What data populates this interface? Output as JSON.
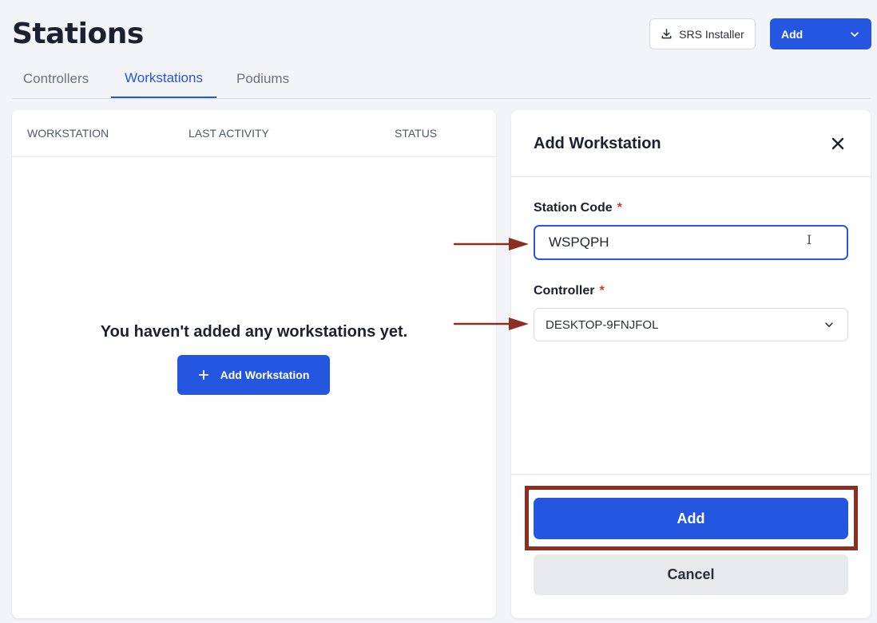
{
  "header": {
    "title": "Stations",
    "srs_installer_label": "SRS Installer",
    "add_label": "Add"
  },
  "tabs": [
    {
      "label": "Controllers",
      "active": false
    },
    {
      "label": "Workstations",
      "active": true
    },
    {
      "label": "Podiums",
      "active": false
    }
  ],
  "list": {
    "columns": [
      "WORKSTATION",
      "LAST ACTIVITY",
      "STATUS"
    ],
    "empty_message": "You haven't added any workstations yet.",
    "add_workstation_label": "Add Workstation"
  },
  "form": {
    "title": "Add Workstation",
    "station_code": {
      "label": "Station Code",
      "required_mark": "*",
      "value": "WSPQPH"
    },
    "controller": {
      "label": "Controller",
      "required_mark": "*",
      "selected": "DESKTOP-9FNJFOL"
    },
    "submit_label": "Add",
    "cancel_label": "Cancel"
  },
  "icons": {
    "download": "download-icon",
    "chevron": "chevron-down-icon",
    "plus": "plus-icon",
    "close": "close-icon",
    "text_cursor": "text-cursor-icon",
    "annotation_arrow": "arrow-right-icon"
  },
  "colors": {
    "primary": "#2456e0",
    "required": "#d63a34",
    "annotation": "#8e2e20",
    "background": "#f3f4f7"
  }
}
